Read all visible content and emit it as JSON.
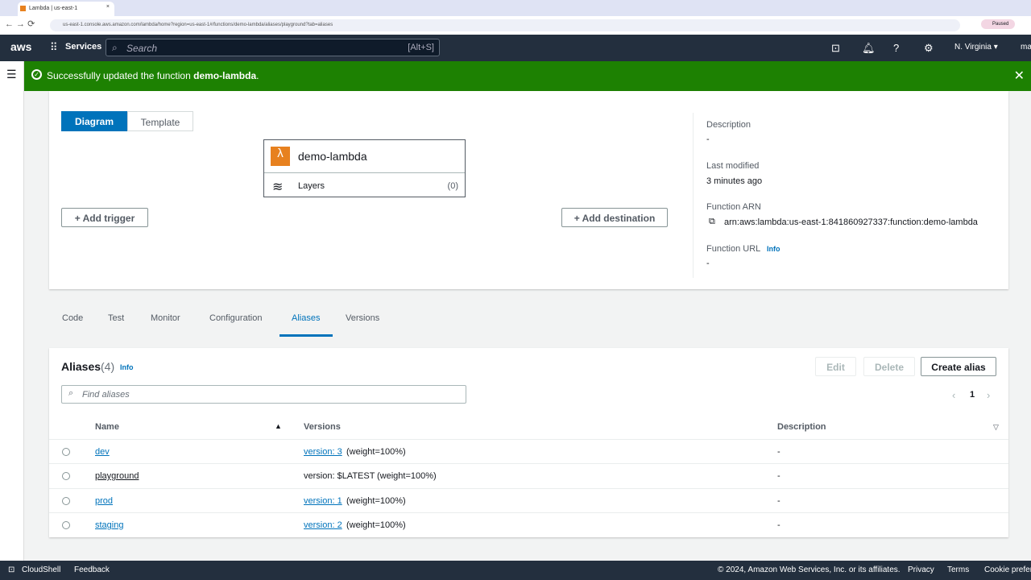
{
  "browser": {
    "tab_title": "Lambda | us-east-1",
    "url": "us-east-1.console.aws.amazon.com/lambda/home?region=us-east-1#/functions/demo-lambda/aliases/playground?tab=aliases",
    "profile": "Paused"
  },
  "nav": {
    "logo": "aws",
    "services": "Services",
    "search_placeholder": "Search",
    "shortcut": "[Alt+S]",
    "region": "N. Virginia ▾",
    "account": "ma"
  },
  "flash": {
    "prefix": "Successfully updated the function ",
    "function": "demo-lambda",
    "suffix": "."
  },
  "overview": {
    "tabs": [
      "Diagram",
      "Template"
    ],
    "function_name": "demo-lambda",
    "layers_label": "Layers",
    "layers_count": "(0)",
    "add_trigger": "Add trigger",
    "add_destination": "Add destination",
    "description_label": "Description",
    "description": "-",
    "last_modified_label": "Last modified",
    "last_modified": "3 minutes ago",
    "arn_label": "Function ARN",
    "arn": "arn:aws:lambda:us-east-1:841860927337:function:demo-lambda",
    "url_label": "Function URL",
    "info": "Info",
    "url": "-"
  },
  "tabs": [
    "Code",
    "Test",
    "Monitor",
    "Configuration",
    "Aliases",
    "Versions"
  ],
  "aliases": {
    "title": "Aliases",
    "count": "(4)",
    "info": "Info",
    "edit": "Edit",
    "delete": "Delete",
    "create": "Create alias",
    "search_placeholder": "Find aliases",
    "page": "1",
    "columns": [
      "Name",
      "Versions",
      "Description"
    ],
    "rows": [
      {
        "name": "dev",
        "version": "version: 3",
        "weight": "(weight=100%)",
        "description": "-",
        "linked": true
      },
      {
        "name": "playground",
        "version": "version: $LATEST",
        "weight": "(weight=100%)",
        "description": "-",
        "linked": false
      },
      {
        "name": "prod",
        "version": "version: 1",
        "weight": "(weight=100%)",
        "description": "-",
        "linked": true
      },
      {
        "name": "staging",
        "version": "version: 2",
        "weight": "(weight=100%)",
        "description": "-",
        "linked": true
      }
    ]
  },
  "footer": {
    "cloudshell": "CloudShell",
    "feedback": "Feedback",
    "copyright": "© 2024, Amazon Web Services, Inc. or its affiliates.",
    "privacy": "Privacy",
    "terms": "Terms",
    "cookies": "Cookie preferences"
  }
}
